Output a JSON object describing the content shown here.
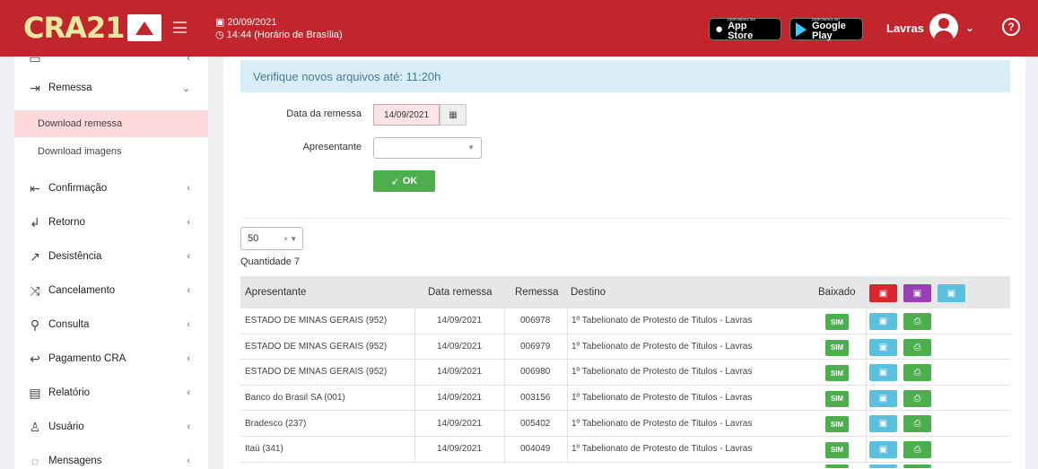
{
  "header": {
    "logo_text": "CRA21",
    "date": "20/09/2021",
    "time": "14:44 (Horário de Brasília)",
    "appstore_small": "DISPONÍVEL NO",
    "appstore_label": "App Store",
    "googleplay_small": "DISPONÍVEL NO",
    "googleplay_label": "Google Play",
    "user_name": "Lavras",
    "help": "?"
  },
  "sidebar": {
    "items": [
      {
        "label": "Remessa",
        "icon": "file-import-icon",
        "arrow": "⌄"
      },
      {
        "label": "Download remessa"
      },
      {
        "label": "Download imagens"
      },
      {
        "label": "Confirmação",
        "icon": "file-export-icon",
        "arrow": "‹"
      },
      {
        "label": "Retorno",
        "icon": "return-icon",
        "arrow": "‹"
      },
      {
        "label": "Desistência",
        "icon": "external-icon",
        "arrow": "‹"
      },
      {
        "label": "Cancelamento",
        "icon": "shuffle-icon",
        "arrow": "‹"
      },
      {
        "label": "Consulta",
        "icon": "search-icon",
        "arrow": "‹"
      },
      {
        "label": "Pagamento CRA",
        "icon": "reply-icon",
        "arrow": "‹"
      },
      {
        "label": "Relatório",
        "icon": "report-icon",
        "arrow": "‹"
      },
      {
        "label": "Usuário",
        "icon": "users-icon",
        "arrow": "‹"
      },
      {
        "label": "Mensagens",
        "icon": "messages-icon",
        "arrow": "‹"
      }
    ]
  },
  "main": {
    "alert": "Verifique novos arquivos até:  11:20h",
    "date_label": "Data da remessa",
    "date_value": "14/09/2021",
    "presenter_label": "Apresentante",
    "presenter_value": "",
    "ok_label": "OK",
    "page_size": "50",
    "quantity": "Quantidade 7",
    "table": {
      "headers": {
        "apresentante": "Apresentante",
        "data": "Data remessa",
        "remessa": "Remessa",
        "destino": "Destino",
        "baixado": "Baixado"
      },
      "rows": [
        {
          "apresentante": "ESTADO DE MINAS GERAIS (952)",
          "data": "14/09/2021",
          "remessa": "006978",
          "destino": "1º Tabelionato de Protesto de Titulos - Lavras",
          "baixado": "SIM"
        },
        {
          "apresentante": "ESTADO DE MINAS GERAIS (952)",
          "data": "14/09/2021",
          "remessa": "006979",
          "destino": "1º Tabelionato de Protesto de Titulos - Lavras",
          "baixado": "SIM"
        },
        {
          "apresentante": "ESTADO DE MINAS GERAIS (952)",
          "data": "14/09/2021",
          "remessa": "006980",
          "destino": "1º Tabelionato de Protesto de Titulos - Lavras",
          "baixado": "SIM"
        },
        {
          "apresentante": "Banco do Brasil SA (001)",
          "data": "14/09/2021",
          "remessa": "003156",
          "destino": "1º Tabelionato de Protesto de Titulos - Lavras",
          "baixado": "SIM"
        },
        {
          "apresentante": "Bradesco (237)",
          "data": "14/09/2021",
          "remessa": "005402",
          "destino": "1º Tabelionato de Protesto de Titulos - Lavras",
          "baixado": "SIM"
        },
        {
          "apresentante": "Itaú (341)",
          "data": "14/09/2021",
          "remessa": "004049",
          "destino": "1º Tabelionato de Protesto de Titulos - Lavras",
          "baixado": "SIM"
        }
      ]
    }
  },
  "colors": {
    "brand_red": "#c0262c",
    "success": "#4cae4c",
    "info": "#5bc0de",
    "purple": "#9b3fb5",
    "danger": "#d9262c"
  }
}
